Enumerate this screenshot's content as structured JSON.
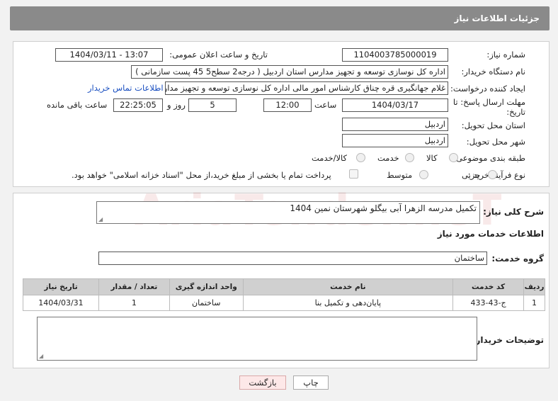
{
  "header": {
    "title": "جزئیات اطلاعات نیاز"
  },
  "fields": {
    "need_number_label": "شماره نیاز:",
    "need_number": "1104003785000019",
    "announce_label": "تاریخ و ساعت اعلان عمومی:",
    "announce_value": "1404/03/11 - 13:07",
    "buyer_label": "نام دستگاه خریدار:",
    "buyer_value": "اداره کل نوسازی   توسعه و تجهیز مدارس استان اردبیل ( درجه2  سطح5  45 پست سازمانی )",
    "creator_label": "ایجاد کننده درخواست:",
    "creator_value": "غلام جهانگیری قره چناق کارشناس امور مالی اداره کل نوسازی   توسعه و تجهیز مدارس",
    "contact_link": "اطلاعات تماس خریدار",
    "deadline_label_1": "مهلت ارسال پاسخ: تا",
    "deadline_label_2": "تاریخ:",
    "deadline_date": "1404/03/17",
    "hour_label": "ساعت",
    "deadline_time": "12:00",
    "days_value": "5",
    "days_label": "روز و",
    "remaining_value": "22:25:05",
    "remaining_label": "ساعت باقی مانده",
    "province_label": "استان محل تحویل:",
    "province_value": "اردبیل",
    "city_label": "شهر محل تحویل:",
    "city_value": "اردبیل",
    "category_label": "طبقه بندی موضوعی:",
    "category_options": [
      "کالا",
      "خدمت",
      "کالا/خدمت"
    ],
    "process_label": "نوع فرآیند خرید :",
    "process_options": [
      "جزیی",
      "متوسط"
    ],
    "payment_note": "پرداخت تمام یا بخشی از مبلغ خرید،از محل \"اسناد خزانه اسلامی\" خواهد بود."
  },
  "summary": {
    "label": "شرح کلی نیاز:",
    "value": "تکمیل مدرسه الزهرا آبی بیگلو شهرستان نمین 1404"
  },
  "services": {
    "section_title": "اطلاعات خدمات مورد نیاز",
    "group_label": "گروه خدمت:",
    "group_value": "ساختمان",
    "table": {
      "headers": [
        "ردیف",
        "کد خدمت",
        "نام خدمت",
        "واحد اندازه گیری",
        "تعداد / مقدار",
        "تاریخ نیاز"
      ],
      "rows": [
        [
          "1",
          "ج-43-433",
          "پایان‌دهی و تکمیل بنا",
          "ساختمان",
          "1",
          "1404/03/31"
        ]
      ]
    }
  },
  "notes_label": "توضیحات خریدار:",
  "buttons": {
    "print": "چاپ",
    "back": "بازگشت"
  },
  "watermark": "AriaTender.neT"
}
